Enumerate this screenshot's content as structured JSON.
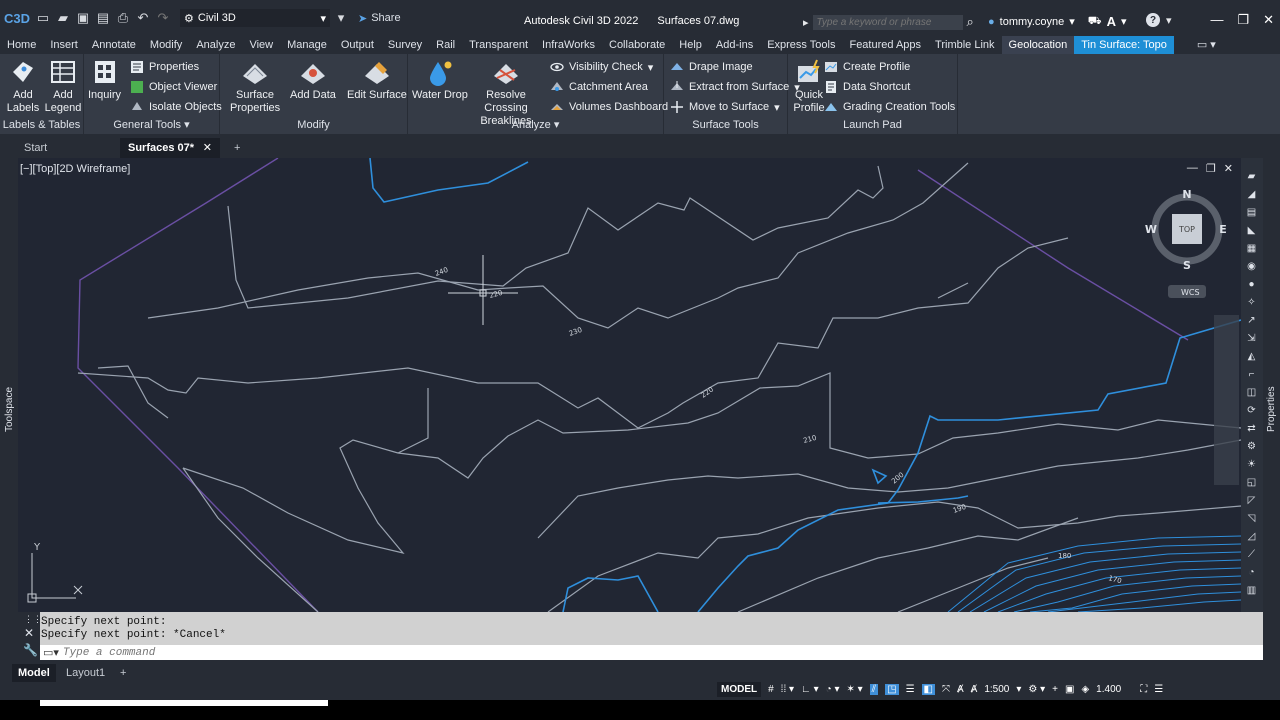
{
  "app": {
    "logo": "C3D",
    "workspace": "Civil 3D",
    "share_label": "Share",
    "title": "Autodesk Civil 3D 2022",
    "file": "Surfaces 07.dwg",
    "search_placeholder": "Type a keyword or phrase",
    "user": "tommy.coyne"
  },
  "tabs": [
    "Home",
    "Insert",
    "Annotate",
    "Modify",
    "Analyze",
    "View",
    "Manage",
    "Output",
    "Survey",
    "Rail",
    "Transparent",
    "InfraWorks",
    "Collaborate",
    "Help",
    "Add-ins",
    "Express Tools",
    "Featured Apps",
    "Trimble Link",
    "Geolocation",
    "Tin Surface: Topo"
  ],
  "ribbon": {
    "labels_tables": {
      "title": "Labels & Tables",
      "add_labels": "Add Labels",
      "add_legend": "Add Legend"
    },
    "general_tools": {
      "title": "General Tools",
      "inquiry": "Inquiry",
      "properties": "Properties",
      "object_viewer": "Object Viewer",
      "isolate_objects": "Isolate Objects"
    },
    "modify": {
      "title": "Modify",
      "surface_properties": "Surface Properties",
      "add_data": "Add Data",
      "edit_surface": "Edit Surface"
    },
    "analyze": {
      "title": "Analyze",
      "water_drop": "Water Drop",
      "resolve_crossing": "Resolve Crossing Breaklines",
      "visibility_check": "Visibility Check",
      "catchment_area": "Catchment Area",
      "volumes_dashboard": "Volumes Dashboard"
    },
    "surface_tools": {
      "title": "Surface Tools",
      "drape_image": "Drape Image",
      "extract_from_surface": "Extract from Surface",
      "move_to_surface": "Move to Surface"
    },
    "launch_pad": {
      "title": "Launch Pad",
      "quick_profile": "Quick Profile",
      "create_profile": "Create Profile",
      "data_shortcut": "Data Shortcut",
      "grading_tools": "Grading Creation Tools"
    }
  },
  "doc_tabs": [
    "Start",
    "Surfaces 07*"
  ],
  "viewport": {
    "label": "[−][Top][2D Wireframe]",
    "viewcube": {
      "n": "N",
      "s": "S",
      "e": "E",
      "w": "W",
      "top": "TOP",
      "wcs": "WCS"
    },
    "ucs_y": "Y",
    "contour_labels": [
      "240",
      "220",
      "230",
      "220",
      "210",
      "200",
      "190",
      "180",
      "170"
    ]
  },
  "side_labels": {
    "left": "Toolspace",
    "right": "Properties"
  },
  "command": {
    "history": [
      "Specify next point:",
      "Specify next point: *Cancel*"
    ],
    "placeholder": "Type a command"
  },
  "layout_tabs": [
    "Model",
    "Layout1"
  ],
  "statusbar": {
    "model": "MODEL",
    "scale": "1:500",
    "value": "1.400"
  },
  "colors": {
    "accent": "#1e8fd6",
    "contour_major": "#2f8fdc",
    "contour_minor": "#9aa3b0",
    "boundary": "#6a4fa3"
  }
}
